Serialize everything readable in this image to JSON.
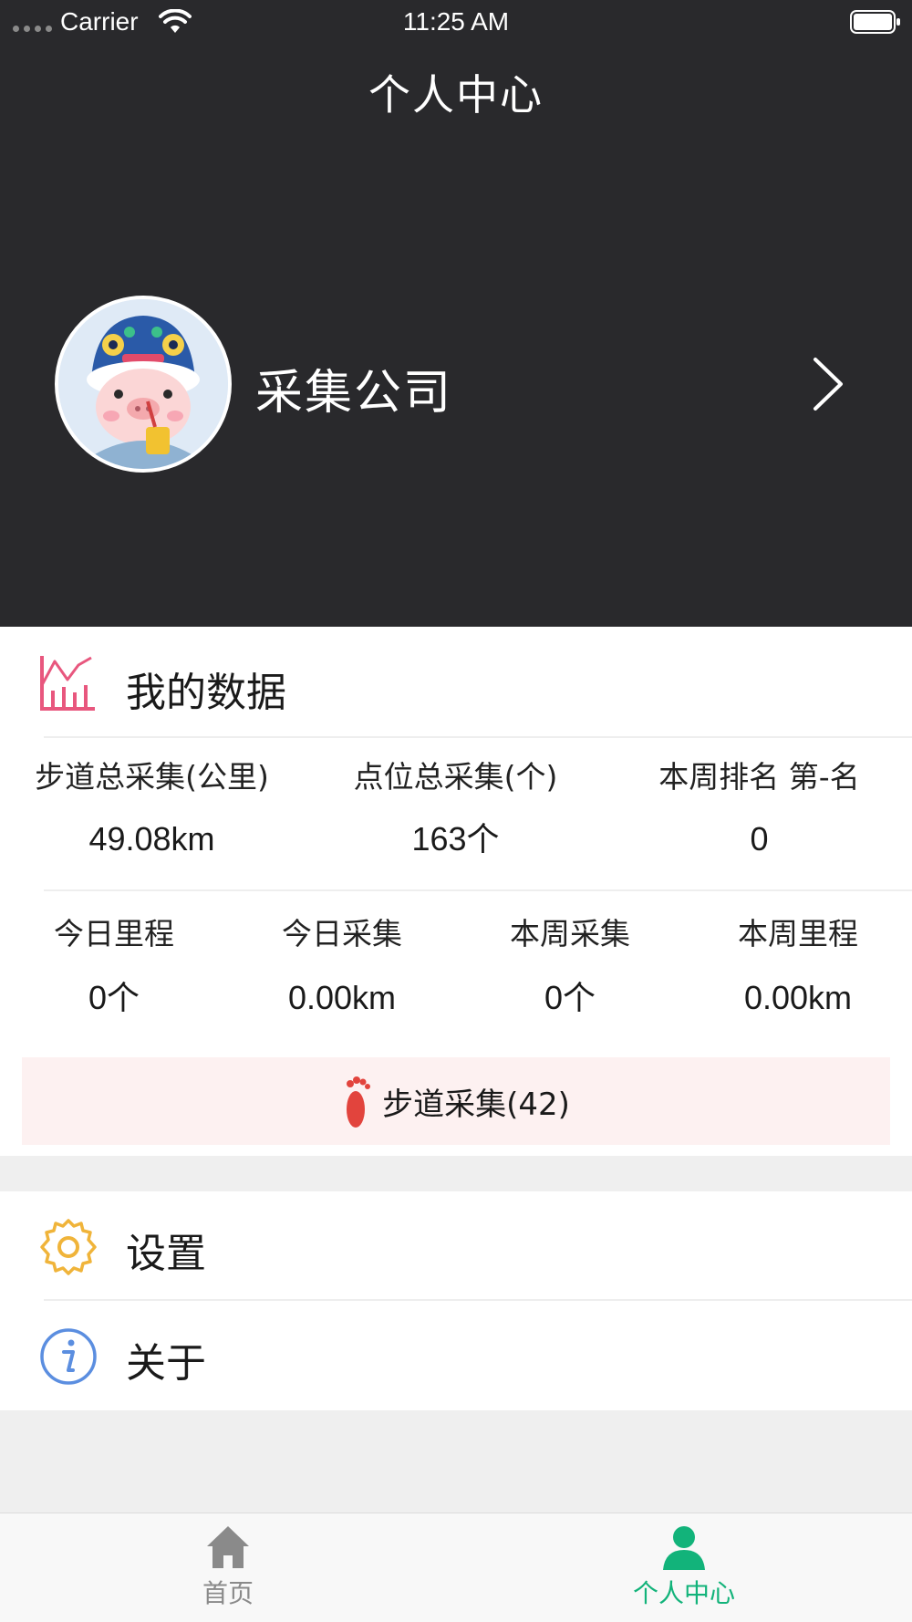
{
  "status_bar": {
    "carrier": "Carrier",
    "time": "11:25 AM"
  },
  "nav": {
    "title": "个人中心"
  },
  "profile": {
    "name": "采集公司"
  },
  "my_data": {
    "title": "我的数据",
    "summary": [
      {
        "label": "步道总采集(公里)",
        "value": "49.08km"
      },
      {
        "label": "点位总采集(个)",
        "value": "163个"
      },
      {
        "label": "本周排名 第-名",
        "value": "0"
      }
    ],
    "details": [
      {
        "label": "今日里程",
        "value": "0个"
      },
      {
        "label": "今日采集",
        "value": "0.00km"
      },
      {
        "label": "本周采集",
        "value": "0个"
      },
      {
        "label": "本周里程",
        "value": "0.00km"
      }
    ],
    "trail_button_label": "步道采集(42)"
  },
  "menu": {
    "settings_label": "设置",
    "about_label": "关于"
  },
  "tabbar": {
    "home_label": "首页",
    "profile_label": "个人中心"
  },
  "colors": {
    "header_bg": "#29292c",
    "accent_green": "#12b37a",
    "chart_icon": "#e8577e",
    "settings_icon": "#f0b43a",
    "about_icon": "#5b8ee0",
    "foot_icon": "#e2443d"
  },
  "icons": {
    "wifi": "wifi-icon",
    "battery": "battery-icon",
    "chevron": "chevron-right-icon",
    "chart": "line-chart-icon",
    "foot": "footprint-icon",
    "settings": "gear-icon",
    "about": "info-icon",
    "home": "home-icon",
    "user": "user-icon"
  }
}
